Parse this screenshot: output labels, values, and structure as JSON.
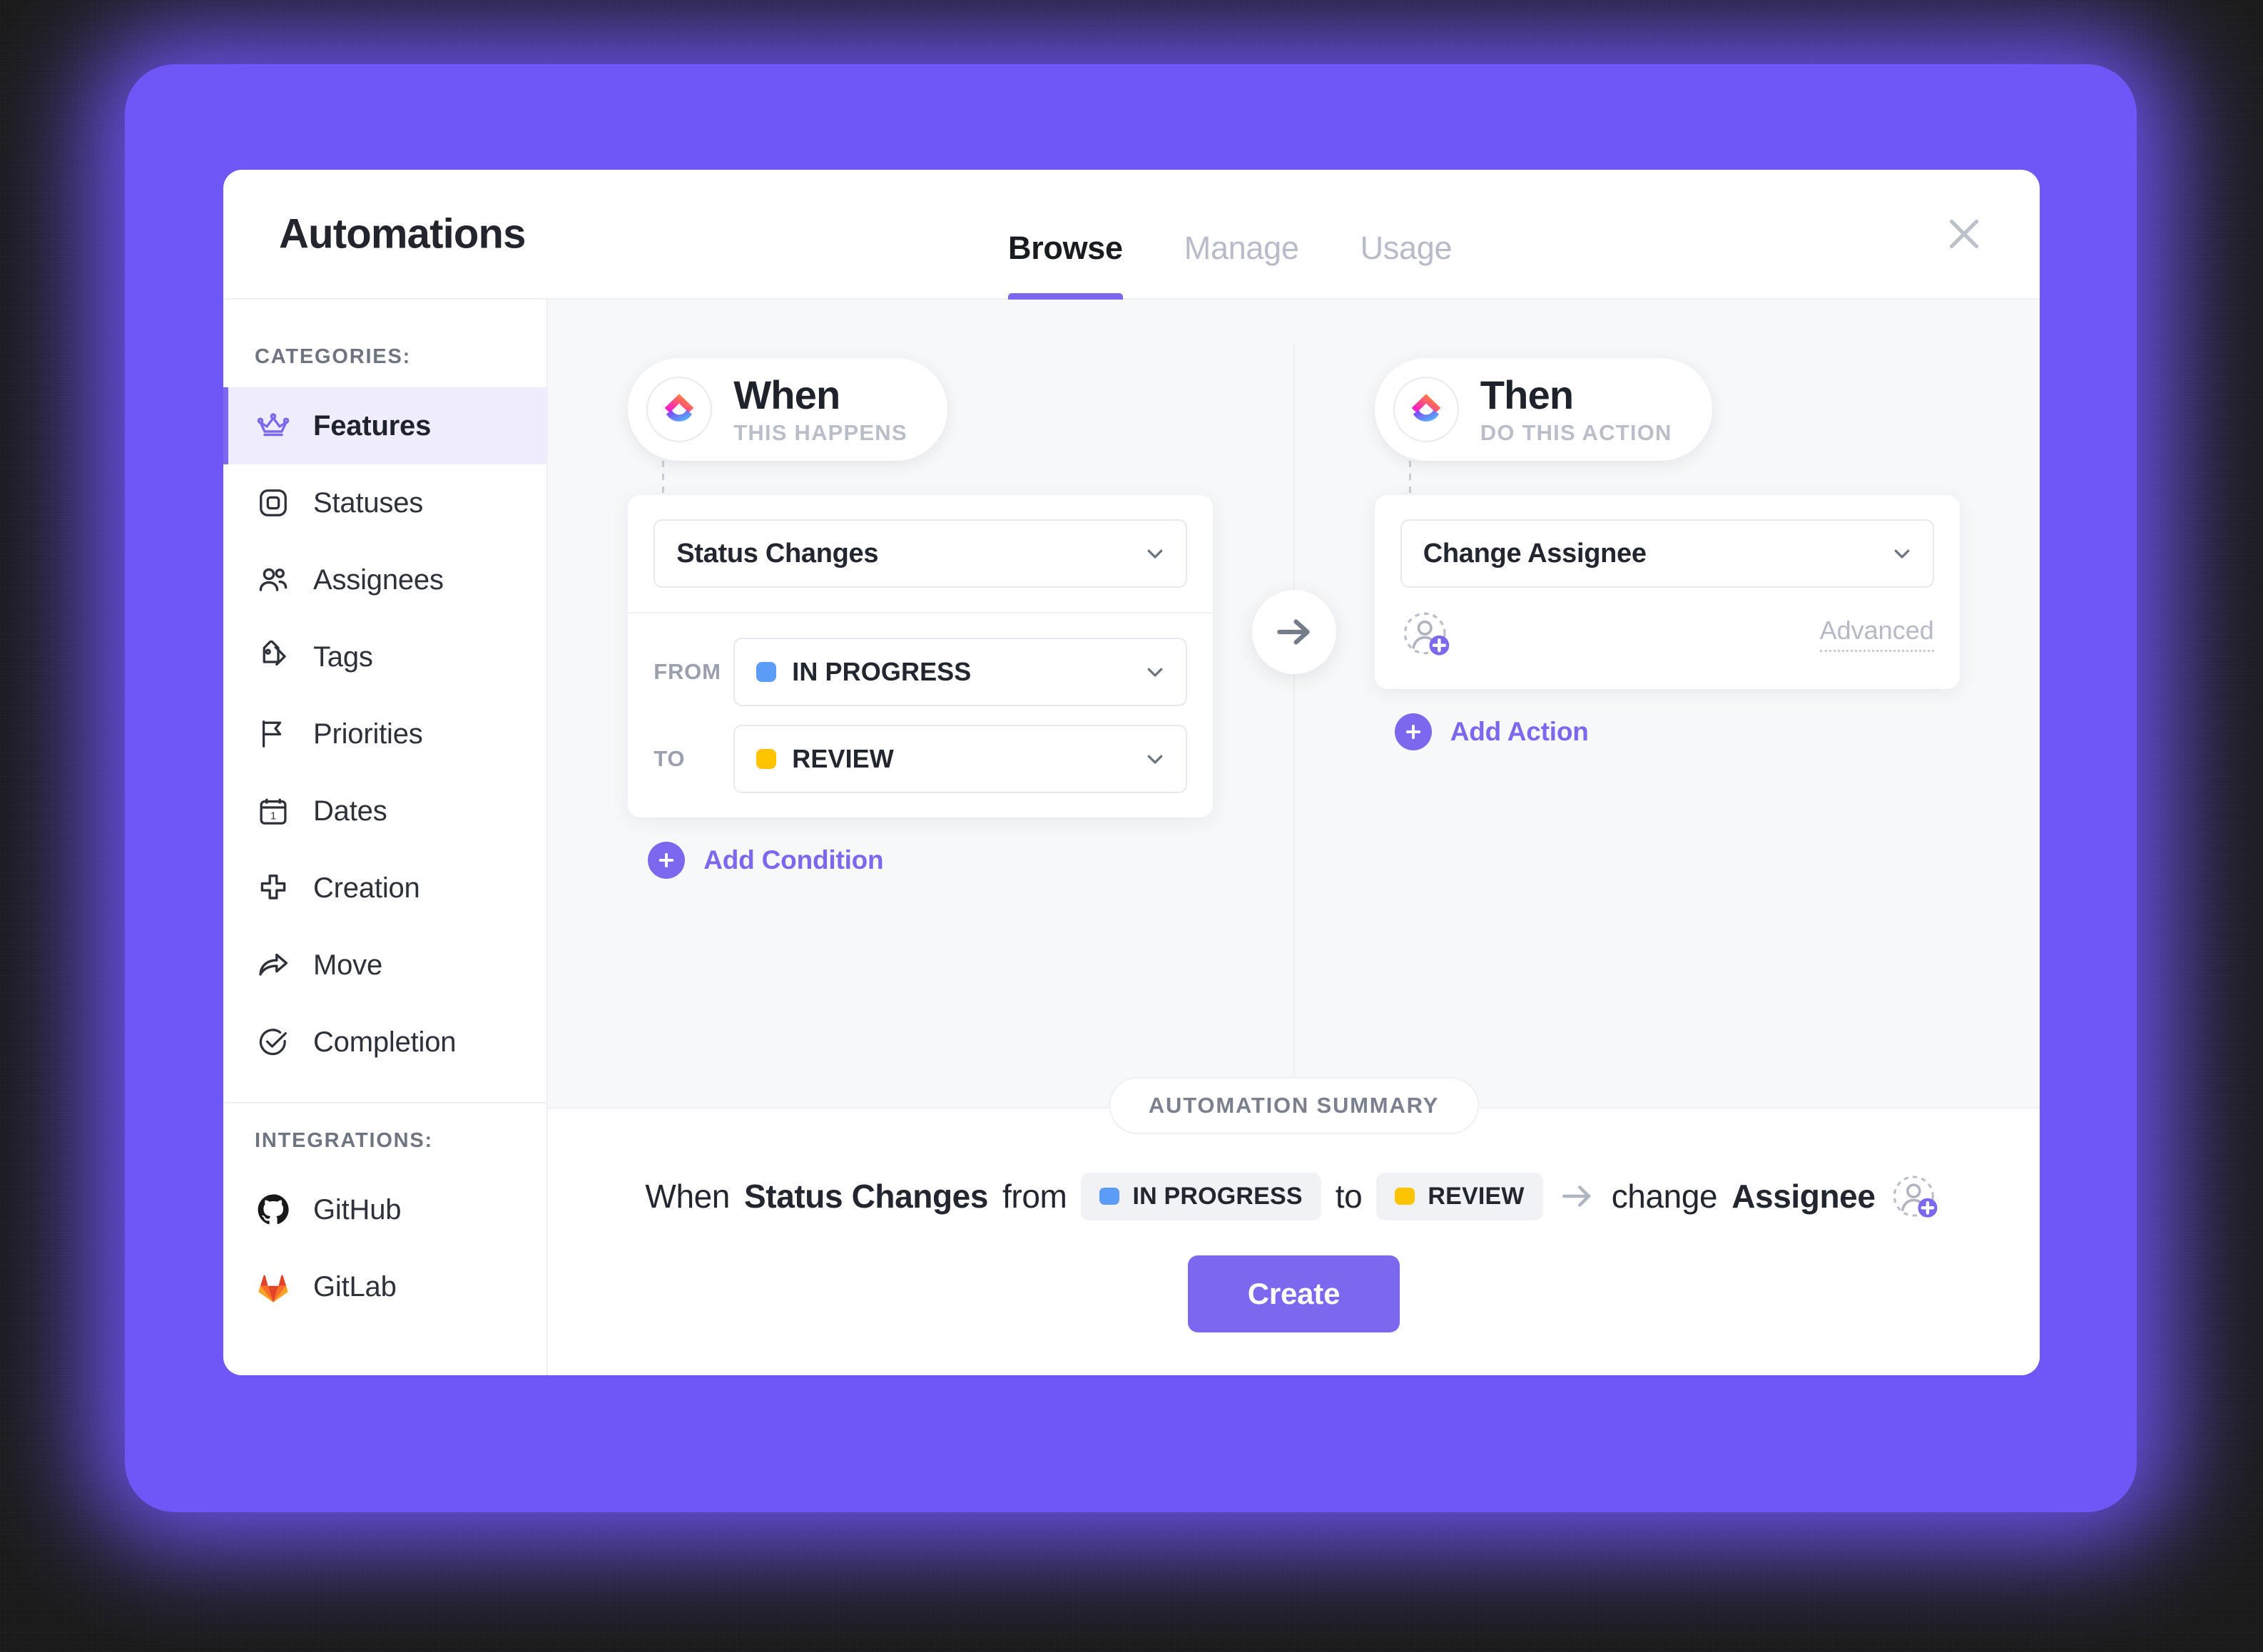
{
  "window": {
    "title": "Automations",
    "close_icon": "close-icon"
  },
  "tabs": [
    {
      "label": "Browse",
      "active": true
    },
    {
      "label": "Manage",
      "active": false
    },
    {
      "label": "Usage",
      "active": false
    }
  ],
  "sidebar": {
    "categories_label": "CATEGORIES:",
    "categories": [
      {
        "label": "Features",
        "icon": "crown-icon",
        "active": true
      },
      {
        "label": "Statuses",
        "icon": "square-status-icon",
        "active": false
      },
      {
        "label": "Assignees",
        "icon": "people-icon",
        "active": false
      },
      {
        "label": "Tags",
        "icon": "tag-icon",
        "active": false
      },
      {
        "label": "Priorities",
        "icon": "flag-icon",
        "active": false
      },
      {
        "label": "Dates",
        "icon": "calendar-icon",
        "active": false
      },
      {
        "label": "Creation",
        "icon": "plus-icon",
        "active": false
      },
      {
        "label": "Move",
        "icon": "share-arrow-icon",
        "active": false
      },
      {
        "label": "Completion",
        "icon": "check-circle-icon",
        "active": false
      }
    ],
    "integrations_label": "INTEGRATIONS:",
    "integrations": [
      {
        "label": "GitHub",
        "icon": "github-icon"
      },
      {
        "label": "GitLab",
        "icon": "gitlab-icon"
      }
    ]
  },
  "flow": {
    "when": {
      "heading": "When",
      "subheading": "THIS HAPPENS",
      "logo_icon": "clickup-logo-icon",
      "trigger": {
        "value": "Status Changes",
        "chevron_icon": "chevron-down-icon"
      },
      "conditions": [
        {
          "label": "FROM",
          "value": "IN PROGRESS",
          "dot_color": "#5B9CF8",
          "chevron_icon": "chevron-down-icon"
        },
        {
          "label": "TO",
          "value": "REVIEW",
          "dot_color": "#FFC400",
          "chevron_icon": "chevron-down-icon"
        }
      ],
      "add_link": {
        "label": "Add Condition",
        "icon": "plus-circle-icon"
      }
    },
    "connector_icon": "arrow-right-icon",
    "then": {
      "heading": "Then",
      "subheading": "DO THIS ACTION",
      "logo_icon": "clickup-logo-icon",
      "action": {
        "value": "Change Assignee",
        "chevron_icon": "chevron-down-icon"
      },
      "assignee_picker_icon": "add-assignee-icon",
      "advanced_label": "Advanced",
      "add_link": {
        "label": "Add Action",
        "icon": "plus-circle-icon"
      }
    }
  },
  "summary": {
    "badge": "AUTOMATION SUMMARY",
    "word_when": "When",
    "trigger": "Status Changes",
    "word_from": "from",
    "from_status": "IN PROGRESS",
    "from_dot_color": "#5B9CF8",
    "word_to": "to",
    "to_status": "REVIEW",
    "to_dot_color": "#FFC400",
    "arrow_icon": "arrow-right-icon",
    "word_change": "change",
    "action_target": "Assignee",
    "assignee_icon": "add-assignee-icon",
    "create_label": "Create"
  },
  "colors": {
    "brand_purple": "#7B68EE",
    "backdrop_purple": "#6F56F6",
    "status_in_progress": "#5B9CF8",
    "status_review": "#FFC400",
    "panel_bg": "#F7F8FA"
  }
}
